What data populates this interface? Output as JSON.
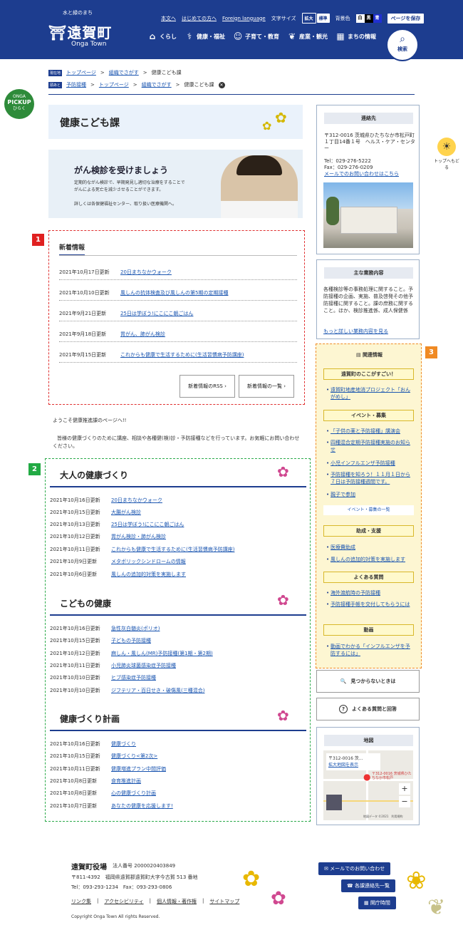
{
  "header": {
    "logo_sub": "水と緑のまち",
    "logo_main": "遠賀町",
    "logo_en": "Onga Town",
    "links": [
      "本文へ",
      "はじめての方へ",
      "Foreign language"
    ],
    "font_size_label": "文字サイズ",
    "font_large": "拡大",
    "font_normal": "標準",
    "bg_label": "背景色",
    "bg_white": "白",
    "bg_black": "黒",
    "bg_blue": "青",
    "save": "ページを保存",
    "nav": [
      "くらし",
      "健康・福祉",
      "子育て・教育",
      "産業・観光",
      "まちの情報"
    ],
    "search": "検索"
  },
  "breadcrumbs": {
    "row1_tag": "現在地",
    "row1": [
      "トップページ",
      "組織でさがす",
      "健康こども課"
    ],
    "row2_tag": "頭あと",
    "row2": [
      "予防接種",
      "トップページ",
      "組織でさがす",
      "健康こども課"
    ]
  },
  "pickup": {
    "top": "ONGA",
    "main": "PICKUP",
    "bottom": "ひらく"
  },
  "totop": "トップへもどる",
  "page_title": "健康こども課",
  "banner": {
    "heading": "がん検診を受けましょう",
    "p1": "定期的ながん検診で、早期発見し適切な治療をすることで",
    "p2": "がんによる死亡を減少させることができます。",
    "p3": "詳しくは各保健福祉センター、取り扱い医療機関へ。"
  },
  "news": {
    "heading": "新着情報",
    "items": [
      {
        "date": "2021年10月17日更新",
        "title": "20日まちなかウォーク"
      },
      {
        "date": "2021年10月10日更新",
        "title": "風しんの抗体検査及び風しんの第5期の定期接種"
      },
      {
        "date": "2021年9月21日更新",
        "title": "25日は学ぼう!にこにこ朝ごはん"
      },
      {
        "date": "2021年9月18日更新",
        "title": "胃がん、肺がん検診"
      },
      {
        "date": "2021年9月15日更新",
        "title": "これからも健康で生活するために(生活習慣病予防講座)"
      }
    ],
    "rss": "新着情報のRSS",
    "list": "新着情報の一覧"
  },
  "intro": {
    "line1": "ようこそ健康推進課のページへ!!",
    "line2": "皆様の健康づくりのために講座、相談や各種健(検)診・予防接種などを行っています。お気軽にお問い合わせください。"
  },
  "sections": [
    {
      "title": "大人の健康づくり",
      "items": [
        {
          "date": "2021年10月16日更新",
          "title": "20日まちなかウォーク"
        },
        {
          "date": "2021年10月15日更新",
          "title": "大腸がん検診"
        },
        {
          "date": "2021年10月13日更新",
          "title": "25日は学ぼう!にこにこ朝ごはん"
        },
        {
          "date": "2021年10月12日更新",
          "title": "胃がん検診・肺がん検診"
        },
        {
          "date": "2021年10月11日更新",
          "title": "これからも健康で生活するために(生活習慣病予防講座)"
        },
        {
          "date": "2021年10月9日更新",
          "title": "メタボリックシンドロームの情報"
        },
        {
          "date": "2021年10月6日更新",
          "title": "風しんの追加的対策を実施します"
        }
      ]
    },
    {
      "title": "こどもの健康",
      "items": [
        {
          "date": "2021年10月16日更新",
          "title": "急性灰白髄炎(ポリオ)"
        },
        {
          "date": "2021年10月15日更新",
          "title": "子どもの予防接種"
        },
        {
          "date": "2021年10月12日更新",
          "title": "麻しん・風しん(MR)予防接種(第1期・第2期)"
        },
        {
          "date": "2021年10月11日更新",
          "title": "小児肺炎球菌感染症予防接種"
        },
        {
          "date": "2021年10月10日更新",
          "title": "ヒブ感染症予防接種"
        },
        {
          "date": "2021年10月10日更新",
          "title": "ジフテリア・百日せき・破傷風(三種混合)"
        }
      ]
    },
    {
      "title": "健康づくり計画",
      "items": [
        {
          "date": "2021年10月16日更新",
          "title": "健康づくり"
        },
        {
          "date": "2021年10月15日更新",
          "title": "健康づくり<第2次>"
        },
        {
          "date": "2021年10月11日更新",
          "title": "健康増進プラン中間評価"
        },
        {
          "date": "2021年10月8日更新",
          "title": "食育推進計画"
        },
        {
          "date": "2021年10月8日更新",
          "title": "心の健康づくり計画"
        },
        {
          "date": "2021年10月7日更新",
          "title": "あなたの健康を応援します!"
        }
      ]
    }
  ],
  "contact": {
    "heading": "連絡先",
    "address": "〒312-0016 茨城県ひたちなか市松戸町１丁目14番１号　ヘルス・ケア・センター",
    "tel": "Tel：029-276-5222",
    "fax": "Fax：029-276-0209",
    "mail": "メールでのお問い合わせはこちら"
  },
  "duties": {
    "heading": "主な業務内容",
    "text": "各種検診等の事務処理に関すること。予防接種の企画、実施、普及啓発その他予防接種に関すること。課の庶務に関すること。ほか、検診推進係、成人保健係",
    "more": "もっと詳しい業務内容を見る"
  },
  "related": {
    "heading": "関連情報",
    "g1": "遠賀町のここがすごい！",
    "g1_links": [
      "遠賀町地産地消プロジェクト「おんがめし」"
    ],
    "g2": "イベント・募集",
    "g2_links": [
      "「子供の薬と予防接種」講演会",
      "四種混合定期予防接種実施のお知らせ",
      "小児インフルエンザ予防接種",
      "予防接種を知ろう！１１月１日から７日は予防接種週間です。",
      "親子で参加"
    ],
    "g2_more": "イベント・募集の一覧",
    "g3": "助成・支援",
    "g3_links": [
      "医療費助成",
      "風しんの追加的対策を実施します"
    ],
    "g4": "よくある質問",
    "g4_links": [
      "海外渡航時の予防接種",
      "予防接種手帳を交付してもらうには"
    ],
    "g5": "動画",
    "g5_links": [
      "動画でわかる「インフルエンザを予防するには」"
    ]
  },
  "notfound": "見つからないときは",
  "faq": "よくある質問と回答",
  "map": {
    "heading": "地図",
    "place": "〒312-0016 茨...",
    "enlarge": "拡大地図を表示",
    "pin": "〒312-0016 茨城県ひたちなか市松戸",
    "copyright": "地図データ ©2021　利用規約"
  },
  "footer": {
    "name": "遠賀町役場",
    "corp": "法人番号 2000020403849",
    "address": "〒811-4392　福岡県遠賀郡遠賀町大字今古賀 513 番地",
    "tel": "Tel：093-293-1234　Fax：093-293-0806",
    "links": [
      "リンク集",
      "アクセシビリティ",
      "個人情報・著作権",
      "サイトマップ"
    ],
    "copyright": "Copyright Onga Town All rights Reserved.",
    "btn_mail": "メールでのお問い合わせ",
    "btn_phone": "各課連絡先一覧",
    "btn_hours": "開庁時間"
  },
  "badges": [
    "1",
    "2",
    "3"
  ],
  "colors": {
    "brand": "#1d3d8f",
    "badge1": "#e02020",
    "badge2": "#22aa44",
    "badge3": "#f08a24"
  }
}
